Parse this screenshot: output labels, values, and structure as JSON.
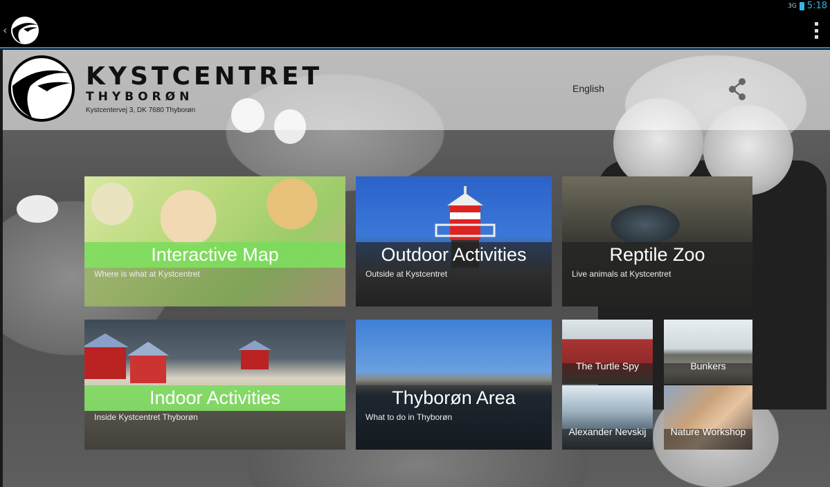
{
  "status_bar": {
    "signal": "3G",
    "time": "5:18"
  },
  "header": {
    "brand_main": "KYSTCENTRET",
    "brand_sub": "THYBORØN",
    "address": "Kystcentervej 3, DK 7680 Thyborøn",
    "language": "English"
  },
  "tiles": {
    "interactive_map": {
      "title": "Interactive Map",
      "subtitle": "Where is what at Kystcentret"
    },
    "outdoor_activities": {
      "title": "Outdoor Activities",
      "subtitle": "Outside at Kystcentret"
    },
    "reptile_zoo": {
      "title": "Reptile Zoo",
      "subtitle": "Live animals at Kystcentret"
    },
    "indoor_activities": {
      "title": "Indoor Activities",
      "subtitle": "Inside Kystcentret Thyborøn"
    },
    "thyboron_area": {
      "title": "Thyborøn Area",
      "subtitle": "What to do in Thyborøn"
    },
    "turtle_spy": {
      "label": "The Turtle Spy"
    },
    "bunkers": {
      "label": "Bunkers"
    },
    "alexander_nevskij": {
      "label": "Alexander Nevskij"
    },
    "nature_workshop": {
      "label": "Nature Workshop"
    }
  },
  "colors": {
    "accent": "#33b5e5",
    "green_band": "#78dc5a",
    "action_bar": "#000000"
  },
  "icons": [
    "back-icon",
    "app-logo-icon",
    "overflow-menu-icon",
    "share-icon",
    "signal-icon",
    "battery-icon"
  ]
}
